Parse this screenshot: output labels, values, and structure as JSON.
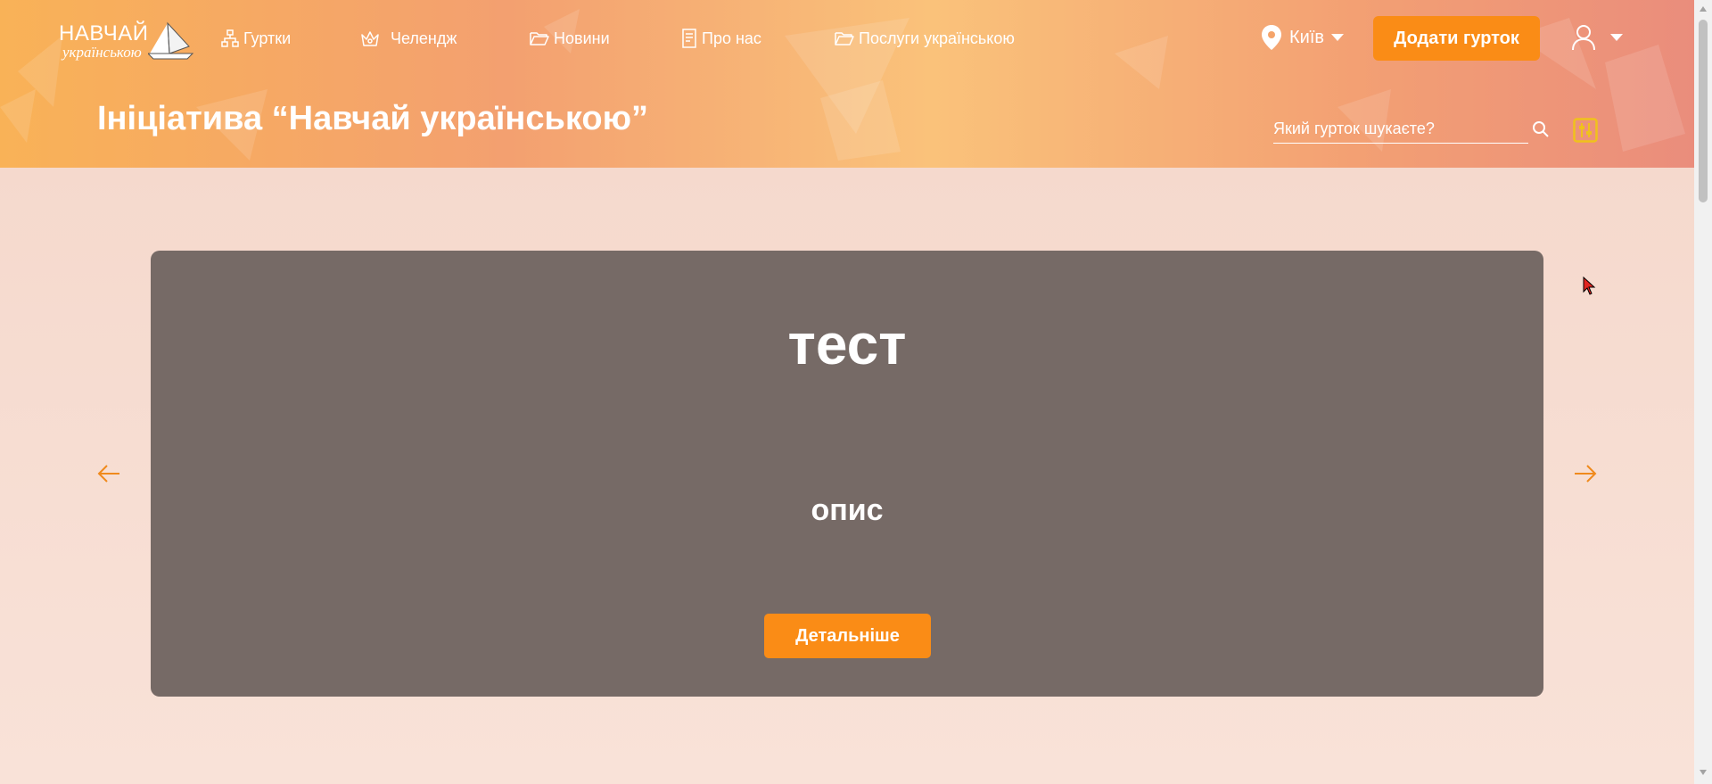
{
  "logo": {
    "line1": "НАВЧАЙ",
    "line2": "українською"
  },
  "nav": [
    {
      "label": "Гуртки",
      "icon": "sitemap-icon"
    },
    {
      "label": "Челендж",
      "icon": "crown-icon"
    },
    {
      "label": "Новини",
      "icon": "folder-icon"
    },
    {
      "label": "Про нас",
      "icon": "document-icon"
    },
    {
      "label": "Послуги українською",
      "icon": "folder-icon"
    }
  ],
  "city": {
    "label": "Київ",
    "icon": "location-pin-icon"
  },
  "add_button": {
    "label": "Додати гурток"
  },
  "page_title": "Ініціатива “Навчай українською”",
  "search": {
    "placeholder": "Який гурток шукаєте?"
  },
  "banner": {
    "title": "тест",
    "description": "опис",
    "button_label": "Детальніше"
  },
  "colors": {
    "accent": "#fa8c16",
    "card_background": "#766a66",
    "page_background": "#f6dcd2"
  }
}
